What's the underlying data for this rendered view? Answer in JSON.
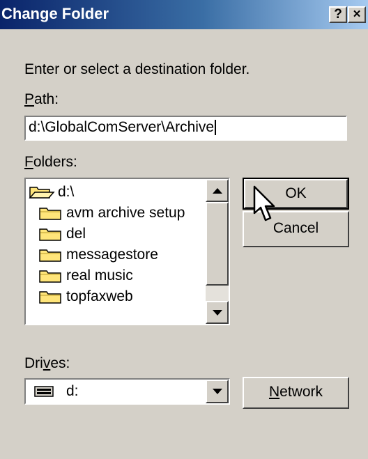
{
  "window": {
    "title": "Change Folder",
    "help_glyph": "?",
    "close_glyph": "×"
  },
  "instruction": "Enter or select a destination folder.",
  "path": {
    "label_access": "P",
    "label_rest": "ath:",
    "value": "d:\\GlobalComServer\\Archive"
  },
  "folders": {
    "label_access": "F",
    "label_rest": "olders:",
    "items": [
      {
        "name": "d:\\",
        "icon": "open-folder-icon"
      },
      {
        "name": "avm archive setup",
        "icon": "folder-icon"
      },
      {
        "name": "del",
        "icon": "folder-icon"
      },
      {
        "name": "messagestore",
        "icon": "folder-icon"
      },
      {
        "name": "real music",
        "icon": "folder-icon"
      },
      {
        "name": "topfaxweb",
        "icon": "folder-icon"
      }
    ]
  },
  "buttons": {
    "ok": "OK",
    "cancel": "Cancel",
    "network_access": "N",
    "network_rest": "etwork"
  },
  "drives": {
    "label_pre": "Dri",
    "label_access": "v",
    "label_post": "es:",
    "value": "d:",
    "icon": "drive-icon"
  },
  "colors": {
    "title_start": "#0a246a",
    "title_end": "#a6caf0",
    "face": "#d4d0c8",
    "folder": "#ffe57a"
  }
}
